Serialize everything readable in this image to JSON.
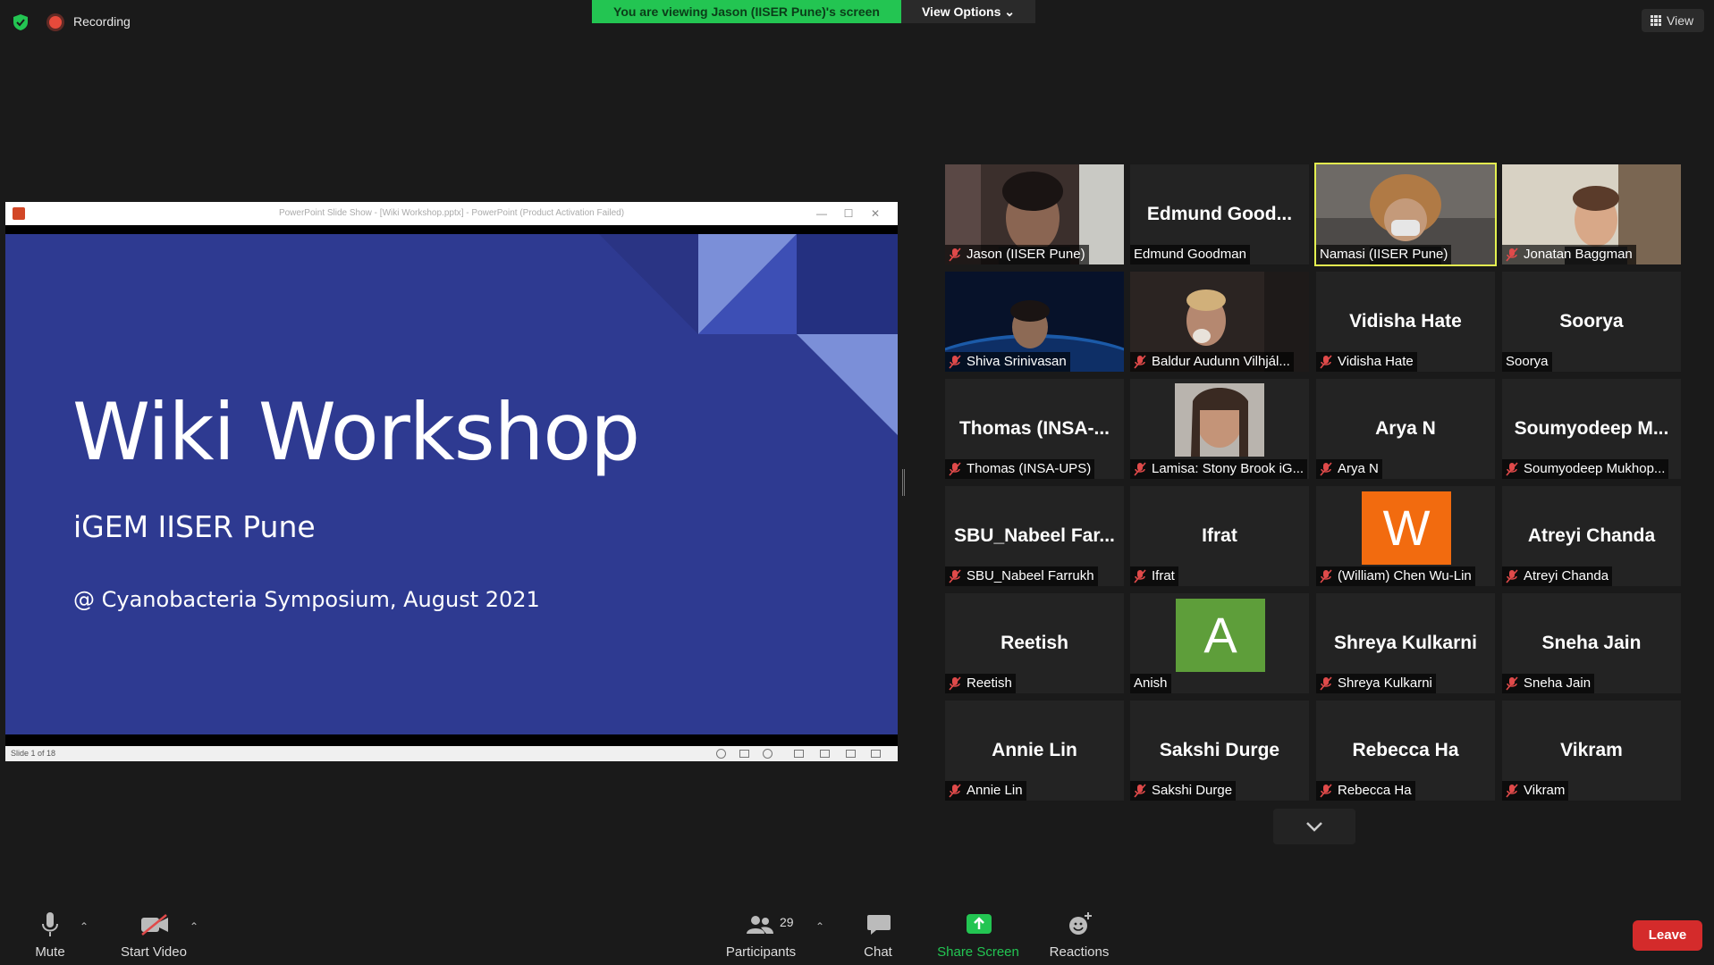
{
  "topbar": {
    "recording_label": "Recording",
    "viewing_banner": "You are viewing Jason (IISER Pune)'s screen",
    "view_options_label": "View Options ⌄",
    "view_label": "View"
  },
  "ppt": {
    "window_title": "PowerPoint Slide Show - [Wiki Workshop.pptx] - PowerPoint (Product Activation Failed)",
    "slide_title": "Wiki Workshop",
    "slide_subtitle": "iGEM IISER Pune",
    "slide_event": "@ Cyanobacteria Symposium, August 2021",
    "slide_counter": "Slide 1 of 18",
    "colors": {
      "slide_bg": "#2e3a91",
      "accent_light": "#7b8fd8",
      "accent_mid": "#3d4fb5",
      "accent_dark": "#243080"
    }
  },
  "gallery": {
    "tiles": [
      {
        "name": "Jason (IISER Pune)",
        "display": "",
        "type": "video",
        "muted": true
      },
      {
        "name": "Edmund Goodman",
        "display": "Edmund Good...",
        "type": "name",
        "muted": false
      },
      {
        "name": "Namasi (IISER Pune)",
        "display": "",
        "type": "video",
        "muted": false,
        "active": true
      },
      {
        "name": "Jonatan Baggman",
        "display": "",
        "type": "video",
        "muted": true
      },
      {
        "name": "Shiva Srinivasan",
        "display": "",
        "type": "video",
        "muted": true
      },
      {
        "name": "Baldur Audunn Vilhjál...",
        "display": "",
        "type": "video",
        "muted": true
      },
      {
        "name": "Vidisha Hate",
        "display": "Vidisha Hate",
        "type": "name",
        "muted": true
      },
      {
        "name": "Soorya",
        "display": "Soorya",
        "type": "name",
        "muted": false
      },
      {
        "name": "Thomas (INSA-UPS)",
        "display": "Thomas (INSA-...",
        "type": "name",
        "muted": true
      },
      {
        "name": "Lamisa: Stony Brook iG...",
        "display": "",
        "type": "portrait",
        "muted": true
      },
      {
        "name": "Arya N",
        "display": "Arya N",
        "type": "name",
        "muted": true
      },
      {
        "name": "Soumyodeep Mukhop...",
        "display": "Soumyodeep M...",
        "type": "name",
        "muted": true
      },
      {
        "name": "SBU_Nabeel Farrukh",
        "display": "SBU_Nabeel Far...",
        "type": "name",
        "muted": true
      },
      {
        "name": "Ifrat",
        "display": "Ifrat",
        "type": "name",
        "muted": true
      },
      {
        "name": "(William) Chen Wu-Lin",
        "display": "",
        "type": "letter",
        "letter": "W",
        "color": "#f26b0f",
        "muted": true
      },
      {
        "name": "Atreyi Chanda",
        "display": "Atreyi Chanda",
        "type": "name",
        "muted": true
      },
      {
        "name": "Reetish",
        "display": "Reetish",
        "type": "name",
        "muted": true
      },
      {
        "name": "Anish",
        "display": "",
        "type": "letter",
        "letter": "A",
        "color": "#5e9e3a",
        "muted": false
      },
      {
        "name": "Shreya Kulkarni",
        "display": "Shreya Kulkarni",
        "type": "name",
        "muted": true
      },
      {
        "name": "Sneha Jain",
        "display": "Sneha Jain",
        "type": "name",
        "muted": true
      },
      {
        "name": "Annie Lin",
        "display": "Annie Lin",
        "type": "name",
        "muted": true
      },
      {
        "name": "Sakshi Durge",
        "display": "Sakshi Durge",
        "type": "name",
        "muted": true
      },
      {
        "name": "Rebecca Ha",
        "display": "Rebecca Ha",
        "type": "name",
        "muted": true
      },
      {
        "name": "Vikram",
        "display": "Vikram",
        "type": "name",
        "muted": true
      }
    ]
  },
  "toolbar": {
    "mute_label": "Mute",
    "start_video_label": "Start Video",
    "participants_label": "Participants",
    "participants_count": "29",
    "chat_label": "Chat",
    "share_screen_label": "Share Screen",
    "reactions_label": "Reactions",
    "leave_label": "Leave"
  }
}
